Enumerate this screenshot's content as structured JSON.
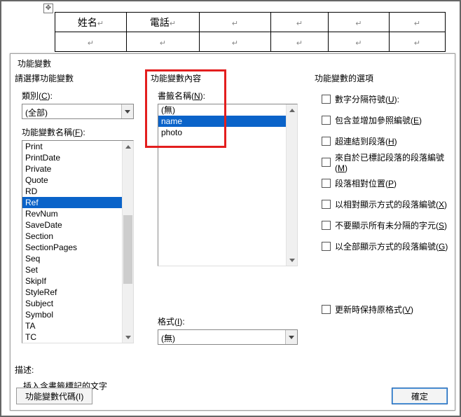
{
  "bg": {
    "col1": "姓名",
    "col2": "電話"
  },
  "dialog": {
    "title": "功能變數",
    "col1_header": "請選擇功能變數",
    "category_label": "類別(C):",
    "category_value": "(全部)",
    "field_names_label": "功能變數名稱(F):",
    "field_names": [
      "Print",
      "PrintDate",
      "Private",
      "Quote",
      "RD",
      "Ref",
      "RevNum",
      "SaveDate",
      "Section",
      "SectionPages",
      "Seq",
      "Set",
      "SkipIf",
      "StyleRef",
      "Subject",
      "Symbol",
      "TA",
      "TC"
    ],
    "field_selected_index": 5,
    "col2_header": "功能變數內容",
    "bookmark_label": "書籤名稱(N):",
    "bookmarks": [
      "(無)",
      "name",
      "photo"
    ],
    "bookmark_selected_index": 1,
    "format_label": "格式(I):",
    "format_value": "(無)",
    "col3_header": "功能變數的選項",
    "options": [
      "數字分隔符號(U):",
      "包含並增加參照編號(E)",
      "超連結到段落(H)",
      "來自於已標記段落的段落編號(M)",
      "段落相對位置(P)",
      "以相對顯示方式的段落編號(X)",
      "不要顯示所有未分隔的字元(S)",
      "以全部顯示方式的段落編號(G)",
      "更新時保持原格式(V)"
    ],
    "desc_label": "描述:",
    "desc_text": "插入含書籤標記的文字",
    "btn_codes": "功能變數代碼(I)",
    "btn_ok": "確定"
  }
}
